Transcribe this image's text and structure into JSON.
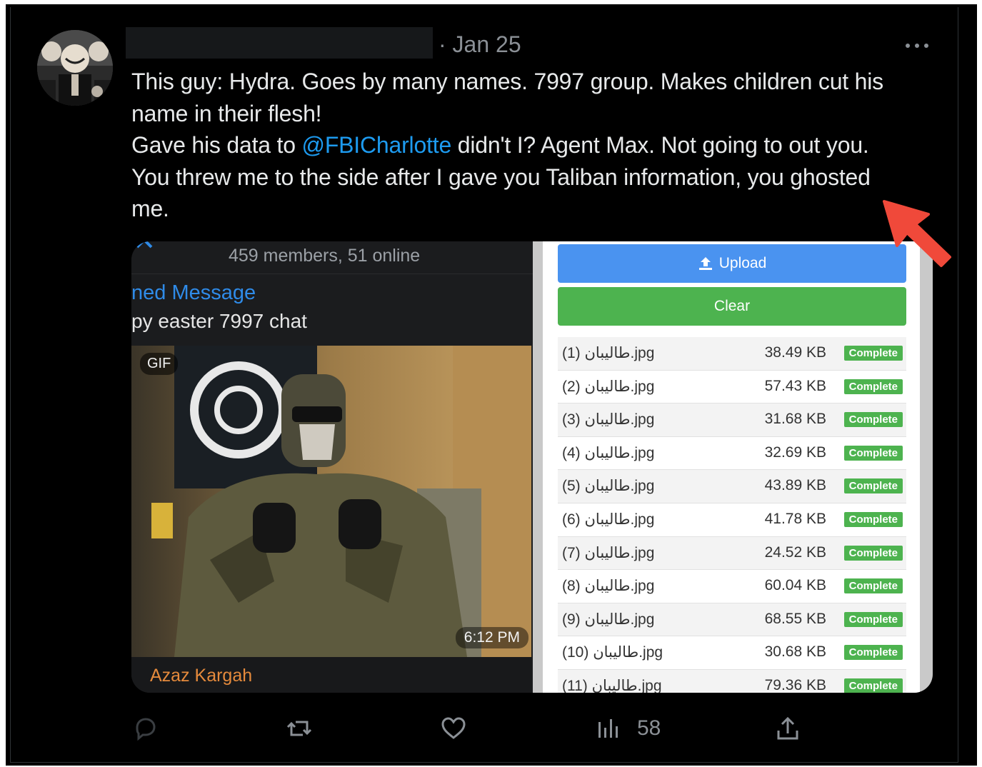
{
  "tweet": {
    "date": "· Jan 25",
    "text_lines": [
      "This guy: Hydra. Goes by many names. 7997 group. Makes children cut his",
      "name in their flesh!"
    ],
    "line3_before": "Gave his data to ",
    "mention": "@FBICharlotte",
    "line3_after": " didn't I? Agent Max. Not going to out you.",
    "line4": "You threw me to the side after I gave you Taliban information, you ghosted",
    "line5": "me."
  },
  "telegram": {
    "members": "459 members, 51 online",
    "pinned_label": "ned Message",
    "pinned_text": "py easter 7997 chat",
    "gif_badge": "GIF",
    "time": "6:12 PM",
    "sender": "Azaz Kargah"
  },
  "uploader": {
    "upload_label": "Upload",
    "clear_label": "Clear",
    "files": [
      {
        "name": "(1) طاليبان.jpg",
        "size": "38.49 KB",
        "status": "Complete"
      },
      {
        "name": "(2) طاليبان.jpg",
        "size": "57.43 KB",
        "status": "Complete"
      },
      {
        "name": "(3) طاليبان.jpg",
        "size": "31.68 KB",
        "status": "Complete"
      },
      {
        "name": "(4) طاليبان.jpg",
        "size": "32.69 KB",
        "status": "Complete"
      },
      {
        "name": "(5) طاليبان.jpg",
        "size": "43.89 KB",
        "status": "Complete"
      },
      {
        "name": "(6) طاليبان.jpg",
        "size": "41.78 KB",
        "status": "Complete"
      },
      {
        "name": "(7) طاليبان.jpg",
        "size": "24.52 KB",
        "status": "Complete"
      },
      {
        "name": "(8) طاليبان.jpg",
        "size": "60.04 KB",
        "status": "Complete"
      },
      {
        "name": "(9) طاليبان.jpg",
        "size": "68.55 KB",
        "status": "Complete"
      },
      {
        "name": "(10) طاليبان.jpg",
        "size": "30.68 KB",
        "status": "Complete"
      },
      {
        "name": "(11) طاليبان.jpg",
        "size": "79.36 KB",
        "status": "Complete"
      }
    ]
  },
  "actions": {
    "views": "58"
  },
  "colors": {
    "background": "#000000",
    "text": "#e7e9ea",
    "muted": "#8b9096",
    "mention": "#1d9bf0",
    "upload_button": "#4a93f0",
    "clear_button": "#4db34f",
    "arrow": "#f0493a"
  },
  "icons": [
    "more-icon",
    "reply-icon",
    "retweet-icon",
    "like-icon",
    "views-icon",
    "share-icon",
    "upload-icon",
    "annotation-arrow"
  ]
}
